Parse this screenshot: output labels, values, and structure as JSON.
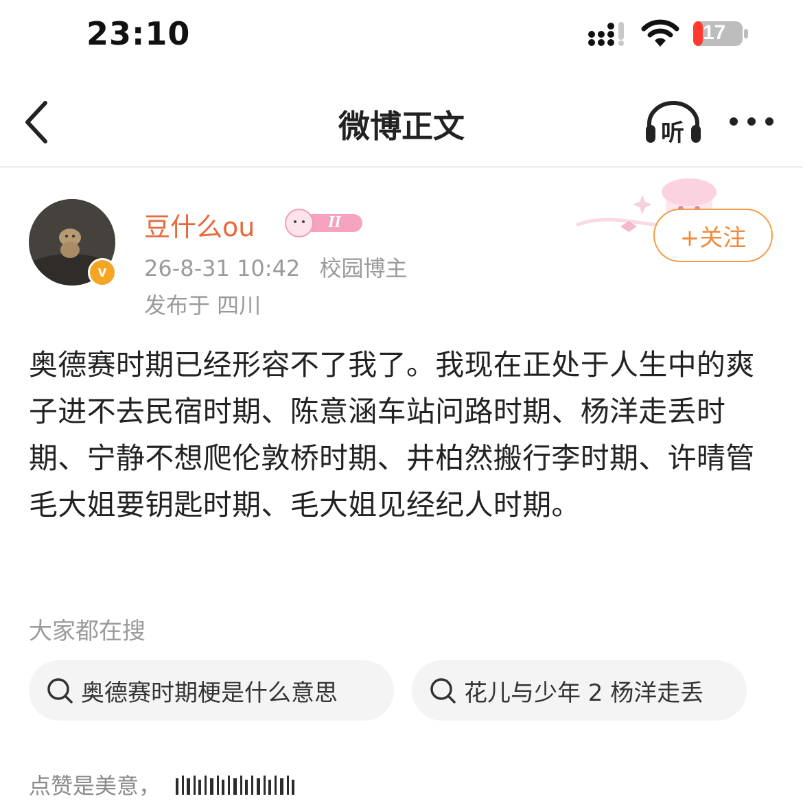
{
  "status_bar": {
    "time": "23:10",
    "battery": "17"
  },
  "header": {
    "title": "微博正文",
    "listen_label": "听"
  },
  "author": {
    "name": "豆什么ou",
    "level_badge": "II",
    "verified_mark": "v",
    "timestamp": "26-8-31 10:42",
    "role": "校园博主",
    "location": "发布于 四川",
    "follow_label": "+关注"
  },
  "post": {
    "text": "奥德赛时期已经形容不了我了。我现在正处于人生中的爽子进不去民宿时期、陈意涵车站问路时期、杨洋走丢时期、宁静不想爬伦敦桥时期、井柏然搬行李时期、许晴管毛大姐要钥匙时期、毛大姐见经纪人时期。"
  },
  "trending": {
    "label": "大家都在搜",
    "items": [
      "奥德赛时期梗是什么意思",
      "花儿与少年 2 杨洋走丢"
    ]
  },
  "footer": {
    "text": "点赞是美意，"
  },
  "colors": {
    "accent": "#e8683a",
    "follow_border": "#f39b45",
    "muted": "#9a9a9a"
  }
}
